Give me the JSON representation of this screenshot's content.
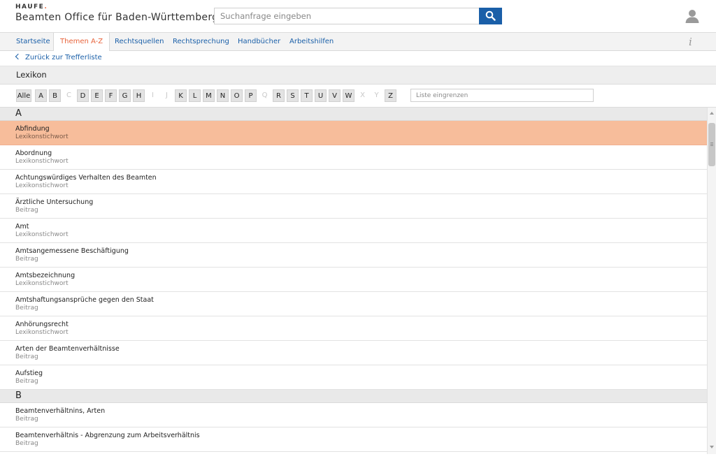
{
  "header": {
    "logo": "HAUFE.",
    "title": "Beamten Office für Baden-Württemberg",
    "search_placeholder": "Suchanfrage eingeben",
    "search_icon": "search-icon",
    "user_icon": "user-icon"
  },
  "nav": {
    "tabs": [
      {
        "label": "Startseite",
        "active": false
      },
      {
        "label": "Themen A-Z",
        "active": true
      },
      {
        "label": "Rechtsquellen",
        "active": false
      },
      {
        "label": "Rechtsprechung",
        "active": false
      },
      {
        "label": "Handbücher",
        "active": false
      },
      {
        "label": "Arbeitshilfen",
        "active": false
      }
    ],
    "info_label": "i"
  },
  "back_link": "Zurück zur Trefferliste",
  "page_title": "Lexikon",
  "letters": [
    {
      "label": "Alle",
      "enabled": true
    },
    {
      "label": "A",
      "enabled": true
    },
    {
      "label": "B",
      "enabled": true
    },
    {
      "label": "C",
      "enabled": false
    },
    {
      "label": "D",
      "enabled": true
    },
    {
      "label": "E",
      "enabled": true
    },
    {
      "label": "F",
      "enabled": true
    },
    {
      "label": "G",
      "enabled": true
    },
    {
      "label": "H",
      "enabled": true
    },
    {
      "label": "I",
      "enabled": false
    },
    {
      "label": "J",
      "enabled": false
    },
    {
      "label": "K",
      "enabled": true
    },
    {
      "label": "L",
      "enabled": true
    },
    {
      "label": "M",
      "enabled": true
    },
    {
      "label": "N",
      "enabled": true
    },
    {
      "label": "O",
      "enabled": true
    },
    {
      "label": "P",
      "enabled": true
    },
    {
      "label": "Q",
      "enabled": false
    },
    {
      "label": "R",
      "enabled": true
    },
    {
      "label": "S",
      "enabled": true
    },
    {
      "label": "T",
      "enabled": true
    },
    {
      "label": "U",
      "enabled": true
    },
    {
      "label": "V",
      "enabled": true
    },
    {
      "label": "W",
      "enabled": true
    },
    {
      "label": "X",
      "enabled": false
    },
    {
      "label": "Y",
      "enabled": false
    },
    {
      "label": "Z",
      "enabled": true
    }
  ],
  "filter_placeholder": "Liste eingrenzen",
  "sections": [
    {
      "letter": "A",
      "items": [
        {
          "title": "Abfindung",
          "type": "Lexikonstichwort",
          "selected": true
        },
        {
          "title": "Abordnung",
          "type": "Lexikonstichwort",
          "selected": false
        },
        {
          "title": "Achtungswürdiges Verhalten des Beamten",
          "type": "Lexikonstichwort",
          "selected": false
        },
        {
          "title": "Ärztliche Untersuchung",
          "type": "Beitrag",
          "selected": false
        },
        {
          "title": "Amt",
          "type": "Lexikonstichwort",
          "selected": false
        },
        {
          "title": "Amtsangemessene Beschäftigung",
          "type": "Beitrag",
          "selected": false
        },
        {
          "title": "Amtsbezeichnung",
          "type": "Lexikonstichwort",
          "selected": false
        },
        {
          "title": "Amtshaftungsansprüche gegen den Staat",
          "type": "Beitrag",
          "selected": false
        },
        {
          "title": "Anhörungsrecht",
          "type": "Lexikonstichwort",
          "selected": false
        },
        {
          "title": "Arten der Beamtenverhältnisse",
          "type": "Beitrag",
          "selected": false
        },
        {
          "title": "Aufstieg",
          "type": "Beitrag",
          "selected": false
        }
      ]
    },
    {
      "letter": "B",
      "items": [
        {
          "title": "Beamtenverhältnins, Arten",
          "type": "Beitrag",
          "selected": false
        },
        {
          "title": "Beamtenverhältnis - Abgrenzung zum Arbeitsverhältnis",
          "type": "Beitrag",
          "selected": false
        }
      ]
    }
  ],
  "colors": {
    "accent": "#e8643c",
    "link": "#1a5fa8",
    "selected_row": "#f7bd9b"
  }
}
